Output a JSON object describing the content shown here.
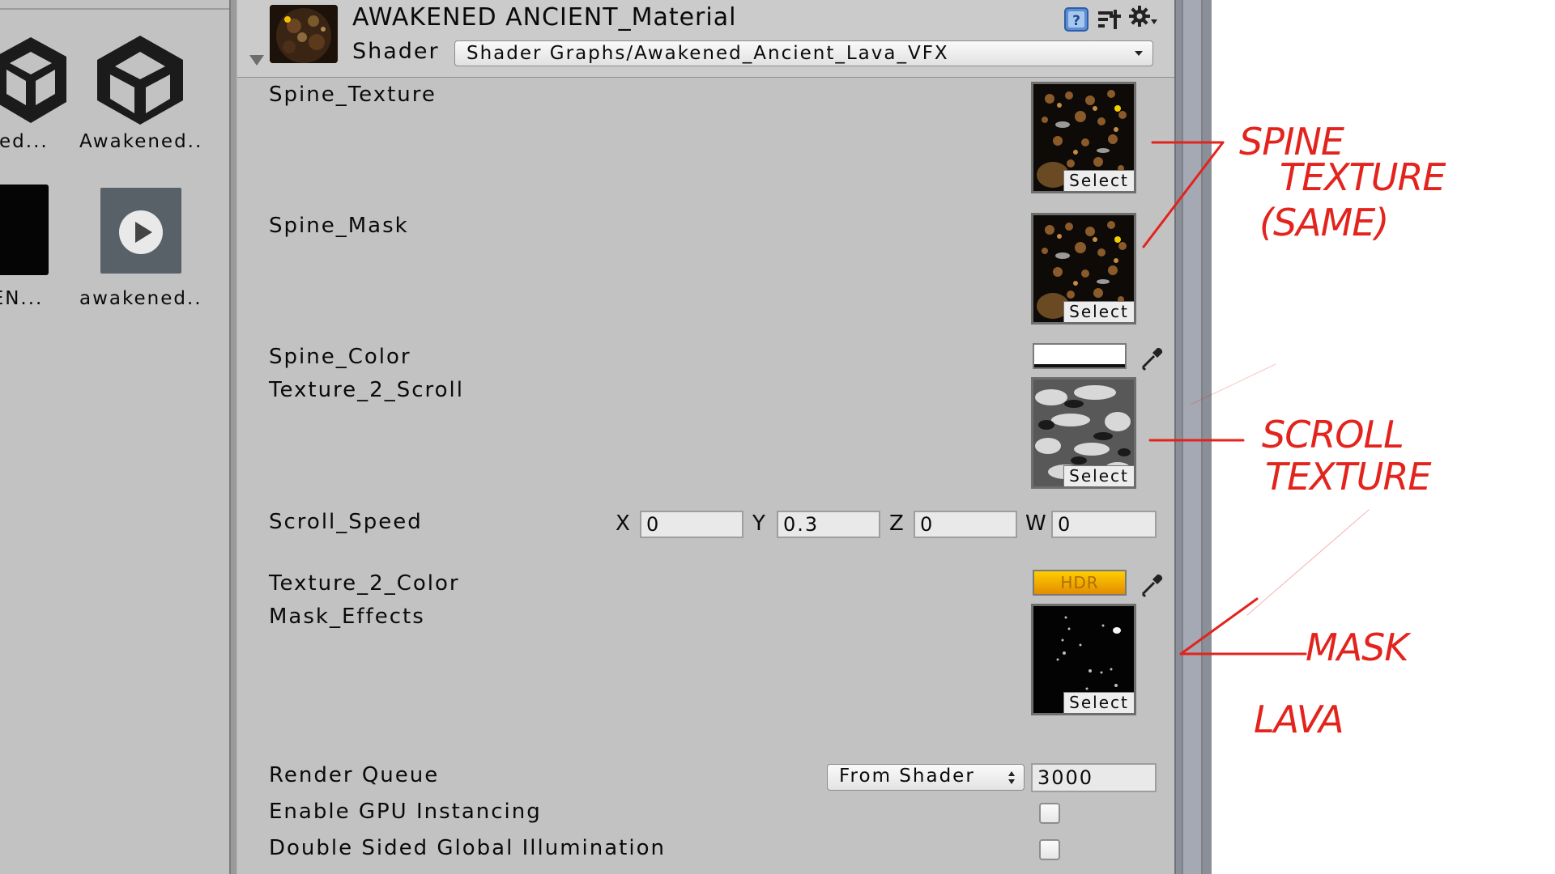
{
  "project": {
    "assets": [
      {
        "label": "ened...",
        "kind": "unity-logo"
      },
      {
        "label": "Awakened...",
        "kind": "unity-logo"
      },
      {
        "label": "KEN...",
        "kind": "black-texture"
      },
      {
        "label": "awakened...",
        "kind": "animation-clip"
      }
    ]
  },
  "inspector": {
    "material_name": "AWAKENED ANCIENT_Material",
    "shader_label": "Shader",
    "shader_value": "Shader Graphs/Awakened_Ancient_Lava_VFX",
    "header_icons": [
      "help-icon",
      "preset-icon",
      "gear-icon"
    ],
    "properties": {
      "spine_texture": {
        "label": "Spine_Texture",
        "select": "Select"
      },
      "spine_mask": {
        "label": "Spine_Mask",
        "select": "Select"
      },
      "spine_color": {
        "label": "Spine_Color",
        "color": "#ffffff"
      },
      "texture_2_scroll": {
        "label": "Texture_2_Scroll",
        "select": "Select"
      },
      "scroll_speed": {
        "label": "Scroll_Speed",
        "x_label": "X",
        "x": "0",
        "y_label": "Y",
        "y": "0.3",
        "z_label": "Z",
        "z": "0",
        "w_label": "W",
        "w": "0"
      },
      "texture_2_color": {
        "label": "Texture_2_Color",
        "hdr_badge": "HDR",
        "color": "#f5a700"
      },
      "mask_effects": {
        "label": "Mask_Effects",
        "select": "Select"
      }
    },
    "render_queue": {
      "label": "Render Queue",
      "mode": "From Shader",
      "value": "3000"
    },
    "gpu_instancing": {
      "label": "Enable GPU Instancing",
      "checked": false
    },
    "double_sided_gi": {
      "label": "Double Sided Global Illumination",
      "checked": false
    }
  },
  "annotations": {
    "spine_texture_note": [
      "SPINE",
      "TEXTURE",
      "(SAME)"
    ],
    "scroll_note": [
      "SCROLL",
      "TEXTURE"
    ],
    "mask_note": [
      "MASK",
      "LAVA"
    ],
    "ink_color": "#e2241d"
  }
}
